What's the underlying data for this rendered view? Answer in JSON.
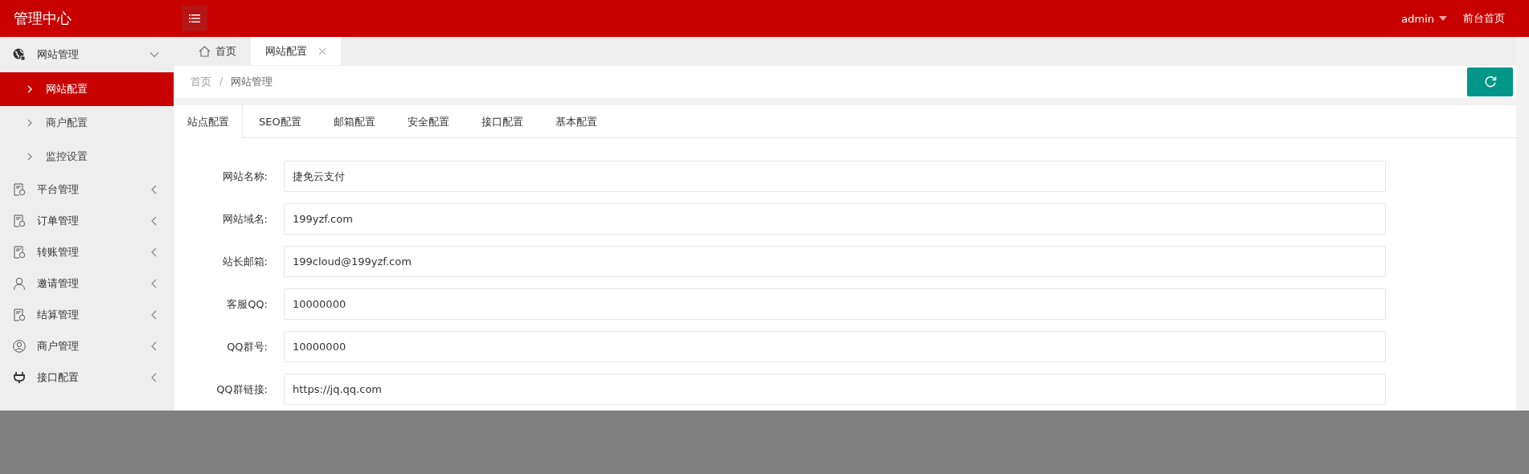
{
  "header": {
    "title": "管理中心",
    "user": "admin",
    "home_link": "前台首页"
  },
  "sidebar": {
    "items": [
      {
        "label": "网站管理",
        "kind": "globe",
        "expanded": true,
        "children": [
          {
            "label": "网站配置",
            "selected": true
          },
          {
            "label": "商户配置",
            "selected": false
          },
          {
            "label": "监控设置",
            "selected": false
          }
        ]
      },
      {
        "label": "平台管理",
        "kind": "doc",
        "expanded": false
      },
      {
        "label": "订单管理",
        "kind": "doc",
        "expanded": false
      },
      {
        "label": "转账管理",
        "kind": "doc",
        "expanded": false
      },
      {
        "label": "邀请管理",
        "kind": "user",
        "expanded": false
      },
      {
        "label": "结算管理",
        "kind": "doc",
        "expanded": false
      },
      {
        "label": "商户管理",
        "kind": "usercircle",
        "expanded": false
      },
      {
        "label": "接口配置",
        "kind": "plug",
        "expanded": false
      }
    ]
  },
  "page_tabs": [
    {
      "label": "首页",
      "kind": "home",
      "selected": false
    },
    {
      "label": "网站配置",
      "kind": "closable",
      "selected": true
    }
  ],
  "breadcrumb": {
    "items": [
      "首页",
      "网站管理"
    ],
    "separator": "/"
  },
  "config_tabs": [
    {
      "label": "站点配置",
      "selected": true
    },
    {
      "label": "SEO配置",
      "selected": false
    },
    {
      "label": "邮箱配置",
      "selected": false
    },
    {
      "label": "安全配置",
      "selected": false
    },
    {
      "label": "接口配置",
      "selected": false
    },
    {
      "label": "基本配置",
      "selected": false
    }
  ],
  "form": [
    {
      "label": "网站名称:",
      "value": "捷免云支付"
    },
    {
      "label": "网站域名:",
      "value": "199yzf.com"
    },
    {
      "label": "站长邮箱:",
      "value": "199cloud@199yzf.com"
    },
    {
      "label": "客服QQ:",
      "value": "10000000"
    },
    {
      "label": "QQ群号:",
      "value": "10000000"
    },
    {
      "label": "QQ群链接:",
      "value": "https://jq.qq.com"
    }
  ]
}
